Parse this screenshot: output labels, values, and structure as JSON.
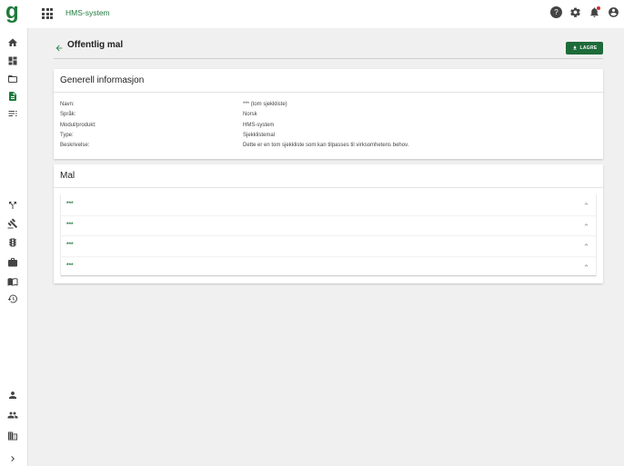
{
  "app": {
    "logo": "g",
    "title": "HMS-system"
  },
  "page": {
    "title": "Offentlig mal",
    "save_label": "LAGRE"
  },
  "general": {
    "title": "Generell informasjon",
    "rows": [
      {
        "label": "Navn:",
        "value": "*** (tom sjekkliste)"
      },
      {
        "label": "Språk:",
        "value": "Norsk"
      },
      {
        "label": "Modul/produkt:",
        "value": "HMS-system"
      },
      {
        "label": "Type:",
        "value": "Sjekklistemal"
      },
      {
        "label": "Beskrivelse:",
        "value": "Dette er en tom sjekkliste som kan tilpasses til virksomhetens behov."
      }
    ]
  },
  "template": {
    "title": "Mal",
    "items": [
      {
        "label": "***"
      },
      {
        "label": "***"
      },
      {
        "label": "***"
      },
      {
        "label": "***"
      }
    ]
  },
  "colors": {
    "brand": "#1e7a3c",
    "button": "#1e6b3a",
    "notification": "#d32f2f"
  },
  "icons": {
    "top": [
      "help-icon",
      "settings-icon",
      "notifications-icon",
      "account-icon"
    ],
    "sidebar": [
      "home-icon",
      "dashboard-icon",
      "folder-icon",
      "document-icon",
      "list-icon",
      "fork-icon",
      "gavel-icon",
      "traffic-light-icon",
      "briefcase-icon",
      "book-icon",
      "history-icon",
      "person-icon",
      "people-icon",
      "building-icon",
      "chevron-right-icon"
    ]
  }
}
